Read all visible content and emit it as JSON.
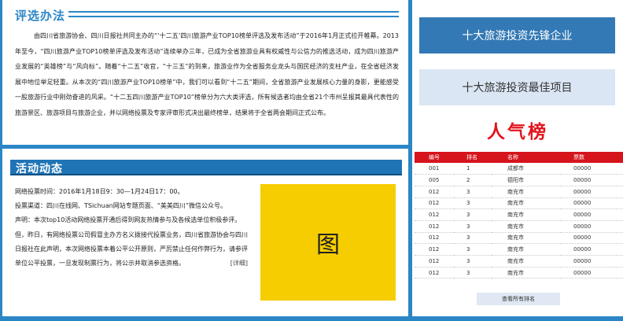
{
  "rules": {
    "title": "评选办法",
    "text": "由四川省旅游协会、四川日报社共同主办的“‘十二五’四川旅游产业TOP10榜单评选及发布活动”于2016年1月正式拉开帷幕。2013年至今，“四川旅游产业TOP10榜单评选及发布活动”连续举办三年，已成为全省旅游业具有权威性与公信力的推选活动，成为四川旅游产业发展的“英雄榜”与“风向标”。随着“十二五”收官，“十三五”的到来，旅游业作为全省服务业龙头与国民经济的支柱产业，在全省经济发展中地位举足轻重。从本次的“四川旅游产业TOP10榜单”中，我们可以看到“十二五”期间，全省旅游产业发展核心力量的身影，更能感受一股旅游行业中刚劲奋进的风采。“十二五四川旅游产业TOP10”榜单分为六大类评选，所有候选者均由全省21个市州呈报其最具代表性的旅游景区、旅游项目与旅游企业，并以网络投票及专家评审形式决出最终榜单，结果将于全省两会期间正式公布。"
  },
  "news": {
    "title": "活动动态",
    "paragraphs": [
      "网络投票时间：2016年1月18日9：30—1月24日17：00。",
      "投票渠道：四川在线网、TSichuan网站专题页面、“美美四川”微信公众号。",
      "声明：本次top10活动网络投票开通后得到网友热情参与及各候选单位积极参评。但，昨日，有网络投票公司假冒主办方名义拨接代投票业务，四川省旅游协会与四川日报社在此声明，本次网络投票本着公平公开原则，严厉禁止任何作弊行为，请参评单位公平投票，一旦发现制票行为，将公示并取消参选资格。"
    ],
    "detail_link": "[详细]",
    "image_label": "图",
    "image_color": "#f6cd00"
  },
  "right": {
    "button1": "十大旅游投资先锋企业",
    "button2": "十大旅游投资最佳项目",
    "popularity_title": "人气榜",
    "table": {
      "headers": [
        "编号",
        "排名",
        "名称",
        "票数"
      ],
      "rows": [
        [
          "001",
          "1",
          "成都市",
          "00000"
        ],
        [
          "005",
          "2",
          "德阳市",
          "00000"
        ],
        [
          "012",
          "3",
          "南充市",
          "00000"
        ],
        [
          "012",
          "3",
          "南充市",
          "00000"
        ],
        [
          "012",
          "3",
          "南充市",
          "00000"
        ],
        [
          "012",
          "3",
          "南充市",
          "00000"
        ],
        [
          "012",
          "3",
          "南充市",
          "00000"
        ],
        [
          "012",
          "3",
          "南充市",
          "00000"
        ],
        [
          "012",
          "3",
          "南充市",
          "00000"
        ],
        [
          "012",
          "3",
          "南充市",
          "00000"
        ]
      ]
    },
    "more_button": "查看所有排名"
  },
  "colors": {
    "accent_blue": "#2b86c6",
    "dark_blue": "#1f74b5",
    "button_blue": "#3379b5",
    "light_blue": "#dbe6f4",
    "red": "#d5141c"
  }
}
